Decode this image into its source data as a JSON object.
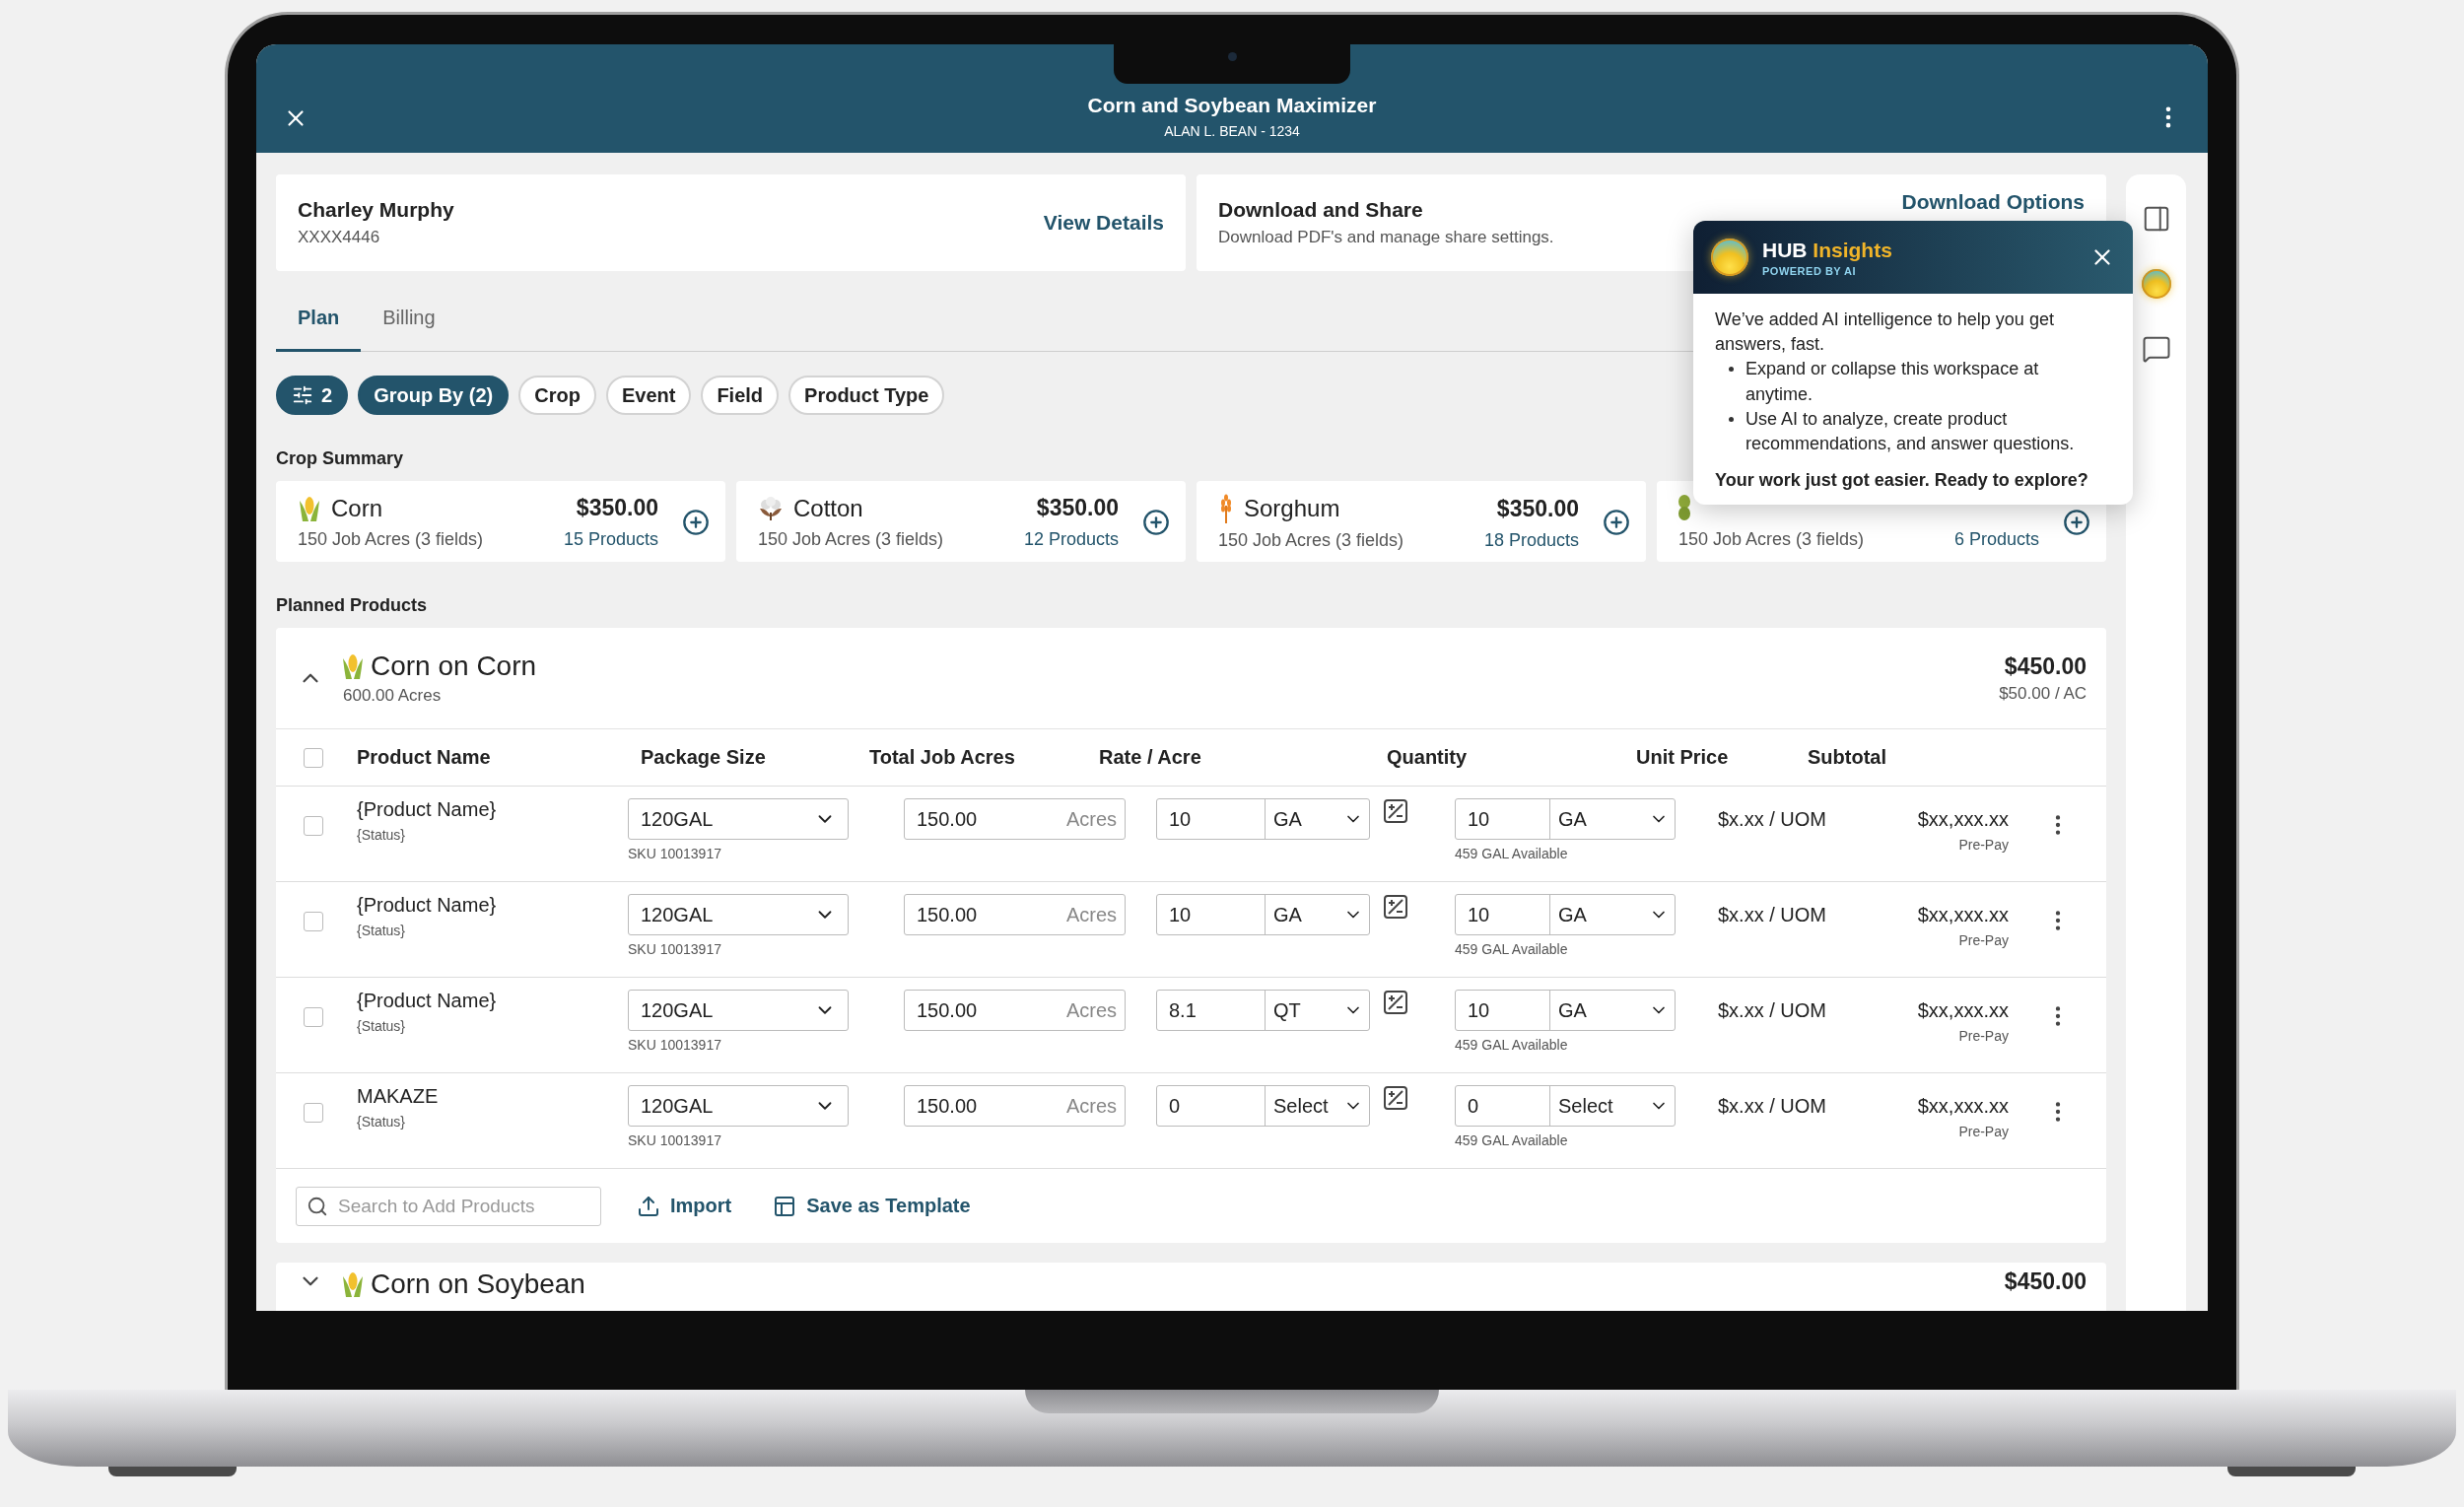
{
  "header": {
    "title": "Corn and Soybean Maximizer",
    "subtitle": "ALAN L. BEAN - 1234"
  },
  "customer": {
    "name": "Charley Murphy",
    "account": "XXXX4446",
    "link": "View Details"
  },
  "download": {
    "title": "Download and Share",
    "description": "Download PDF's and manage share settings.",
    "link": "Download Options"
  },
  "tabs": [
    {
      "label": "Plan",
      "selected": true
    },
    {
      "label": "Billing",
      "selected": false
    }
  ],
  "filters": [
    {
      "kind": "filter-count",
      "label": "2",
      "selected": true
    },
    {
      "kind": "chip",
      "label": "Group By (2)",
      "selected": true
    },
    {
      "kind": "chip",
      "label": "Crop",
      "selected": false
    },
    {
      "kind": "chip",
      "label": "Event",
      "selected": false
    },
    {
      "kind": "chip",
      "label": "Field",
      "selected": false
    },
    {
      "kind": "chip",
      "label": "Product Type",
      "selected": false
    }
  ],
  "crop_summary": {
    "title": "Crop Summary",
    "cards": [
      {
        "kind": "corn",
        "crop": "Corn",
        "price": "$350.00",
        "acres": "150 Job Acres (3 fields)",
        "products": "15 Products"
      },
      {
        "kind": "cotton",
        "crop": "Cotton",
        "price": "$350.00",
        "acres": "150 Job Acres (3 fields)",
        "products": "12 Products"
      },
      {
        "kind": "sorghum",
        "crop": "Sorghum",
        "price": "$350.00",
        "acres": "150 Job Acres (3 fields)",
        "products": "18 Products"
      },
      {
        "kind": "soybean",
        "acres": "150 Job Acres (3 fields)",
        "products": "6 Products"
      }
    ]
  },
  "planned_products": {
    "title": "Planned Products",
    "groups": [
      {
        "name": "Corn on Corn",
        "acres": "600.00 Acres",
        "total": "$450.00",
        "per_acre": "$50.00 / AC",
        "expanded": true,
        "select_all": false,
        "columns": [
          "Product Name",
          "Package Size",
          "Total Job Acres",
          "Rate / Acre",
          "Quantity",
          "Unit Price",
          "Subtotal"
        ],
        "rows": [
          {
            "selected": false,
            "product": "{Product Name}",
            "status": "{Status}",
            "package": "120GAL",
            "sku": "SKU 10013917",
            "acres": "150.00",
            "acres_unit": "Acres",
            "rate": "10",
            "rate_unit": "GA",
            "quantity": "10",
            "quantity_unit": "GA",
            "available": "459 GAL Available",
            "unit_price": "$x.xx / UOM",
            "subtotal": "$xx,xxx.xx",
            "payment": "Pre-Pay"
          },
          {
            "selected": false,
            "product": "{Product Name}",
            "status": "{Status}",
            "package": "120GAL",
            "sku": "SKU 10013917",
            "acres": "150.00",
            "acres_unit": "Acres",
            "rate": "10",
            "rate_unit": "GA",
            "quantity": "10",
            "quantity_unit": "GA",
            "available": "459 GAL Available",
            "unit_price": "$x.xx / UOM",
            "subtotal": "$xx,xxx.xx",
            "payment": "Pre-Pay"
          },
          {
            "selected": false,
            "product": "{Product Name}",
            "status": "{Status}",
            "package": "120GAL",
            "sku": "SKU 10013917",
            "acres": "150.00",
            "acres_unit": "Acres",
            "rate": "8.1",
            "rate_unit": "QT",
            "quantity": "10",
            "quantity_unit": "GA",
            "available": "459 GAL Available",
            "unit_price": "$x.xx / UOM",
            "subtotal": "$xx,xxx.xx",
            "payment": "Pre-Pay"
          },
          {
            "selected": false,
            "product": "MAKAZE",
            "status": "{Status}",
            "package": "120GAL",
            "sku": "SKU 10013917",
            "acres": "150.00",
            "acres_unit": "Acres",
            "rate": "0",
            "rate_unit": "Select",
            "quantity": "0",
            "quantity_unit": "Select",
            "available": "459 GAL Available",
            "unit_price": "$x.xx / UOM",
            "subtotal": "$xx,xxx.xx",
            "payment": "Pre-Pay"
          }
        ],
        "footer": {
          "search_placeholder": "Search to Add Products",
          "import": "Import",
          "save_template": "Save as Template"
        }
      },
      {
        "name": "Corn on Soybean",
        "total": "$450.00",
        "expanded": false
      }
    ]
  },
  "popup": {
    "brand": "HUB",
    "brand_accent": "Insights",
    "tagline": "POWERED BY AI",
    "intro": "We’ve added AI intelligence to help you get answers, fast.",
    "bullets": [
      "Expand or collapse this workspace at anytime.",
      "Use AI to analyze, create product recommendations, and answer questions."
    ],
    "closing": "Your work just got easier. Ready to explore?"
  }
}
